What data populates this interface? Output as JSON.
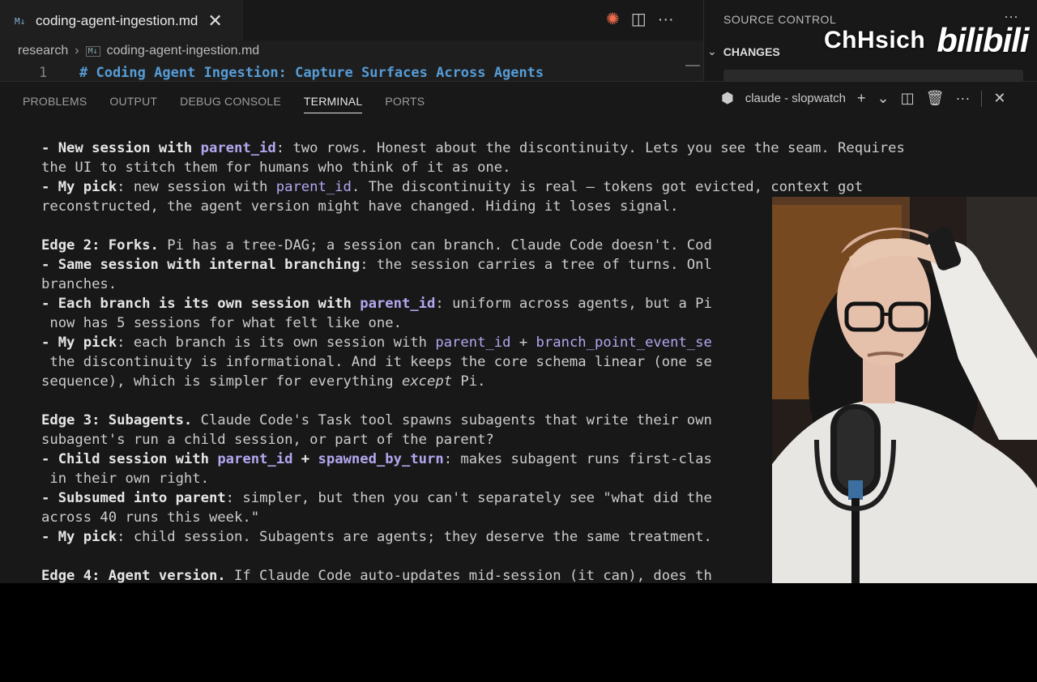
{
  "editor": {
    "tab": {
      "icon": "markdown-icon",
      "icon_text": "M↓",
      "title": "coding-agent-ingestion.md",
      "close": "✕"
    },
    "breadcrumb": {
      "folder": "research",
      "icon_text": "M↓",
      "file": "coding-agent-ingestion.md"
    },
    "line_number": "1",
    "line_text": "# Coding Agent Ingestion: Capture Surfaces Across Agents",
    "actions": [
      "spark-icon",
      "split-editor-icon",
      "more-icon"
    ]
  },
  "source_control": {
    "title": "SOURCE CONTROL",
    "section": "CHANGES",
    "more": "···"
  },
  "watermark": {
    "name": "ChHsich",
    "logo": "bilibili"
  },
  "panel": {
    "tabs": [
      "PROBLEMS",
      "OUTPUT",
      "DEBUG CONSOLE",
      "TERMINAL",
      "PORTS"
    ],
    "active_tab": "TERMINAL",
    "terminal_name": "claude - slopwatch"
  },
  "terminal": {
    "lines": [
      [
        {
          "t": "- ",
          "s": "b"
        },
        {
          "t": "New session with ",
          "s": "b"
        },
        {
          "t": "parent_id",
          "s": "bcode"
        },
        {
          "t": ": two rows. Honest about the discontinuity. Lets you see the seam. Requires"
        }
      ],
      [
        {
          "t": "the UI to stitch them for humans who think of it as one."
        }
      ],
      [
        {
          "t": "- ",
          "s": "b"
        },
        {
          "t": "My pick",
          "s": "b"
        },
        {
          "t": ": new session with "
        },
        {
          "t": "parent_id",
          "s": "code"
        },
        {
          "t": ". The discontinuity is real — tokens got evicted, context got"
        }
      ],
      [
        {
          "t": "reconstructed, the agent version might have changed. Hiding it loses signal."
        }
      ],
      [
        {
          "t": ""
        }
      ],
      [
        {
          "t": "Edge 2: Forks.",
          "s": "b"
        },
        {
          "t": " Pi has a tree-DAG; a session can branch. Claude Code doesn't. Cod"
        }
      ],
      [
        {
          "t": "- ",
          "s": "b"
        },
        {
          "t": "Same session with internal branching",
          "s": "b"
        },
        {
          "t": ": the session carries a tree of turns. Onl"
        }
      ],
      [
        {
          "t": "branches."
        }
      ],
      [
        {
          "t": "- ",
          "s": "b"
        },
        {
          "t": "Each branch is its own session with ",
          "s": "b"
        },
        {
          "t": "parent_id",
          "s": "bcode"
        },
        {
          "t": ": uniform across agents, but a Pi"
        }
      ],
      [
        {
          "t": " now has 5 sessions for what felt like one."
        }
      ],
      [
        {
          "t": "- ",
          "s": "b"
        },
        {
          "t": "My pick",
          "s": "b"
        },
        {
          "t": ": each branch is its own session with "
        },
        {
          "t": "parent_id",
          "s": "code"
        },
        {
          "t": " + "
        },
        {
          "t": "branch_point_event_se",
          "s": "code"
        }
      ],
      [
        {
          "t": " the discontinuity is informational. And it keeps the core schema linear (one se"
        }
      ],
      [
        {
          "t": "sequence), which is simpler for everything "
        },
        {
          "t": "except",
          "s": "it"
        },
        {
          "t": " Pi."
        }
      ],
      [
        {
          "t": ""
        }
      ],
      [
        {
          "t": "Edge 3: Subagents.",
          "s": "b"
        },
        {
          "t": " Claude Code's Task tool spawns subagents that write their own"
        }
      ],
      [
        {
          "t": "subagent's run a child session, or part of the parent?"
        }
      ],
      [
        {
          "t": "- ",
          "s": "b"
        },
        {
          "t": "Child session with ",
          "s": "b"
        },
        {
          "t": "parent_id",
          "s": "bcode"
        },
        {
          "t": " + ",
          "s": "b"
        },
        {
          "t": "spawned_by_turn",
          "s": "bcode"
        },
        {
          "t": ": makes subagent runs first-clas"
        }
      ],
      [
        {
          "t": " in their own right."
        }
      ],
      [
        {
          "t": "- ",
          "s": "b"
        },
        {
          "t": "Subsumed into parent",
          "s": "b"
        },
        {
          "t": ": simpler, but then you can't separately see \"what did the"
        }
      ],
      [
        {
          "t": "across 40 runs this week.\""
        }
      ],
      [
        {
          "t": "- ",
          "s": "b"
        },
        {
          "t": "My pick",
          "s": "b"
        },
        {
          "t": ": child session. Subagents are agents; they deserve the same treatment."
        }
      ],
      [
        {
          "t": ""
        }
      ],
      [
        {
          "t": "Edge 4: Agent version.",
          "s": "b"
        },
        {
          "t": " If Claude Code auto-updates mid-session (it can), does th"
        }
      ]
    ]
  },
  "colors": {
    "editor_bg": "#1e1e1e",
    "panel_bg": "#181818",
    "keyword_blue": "#569cd6",
    "code_purple": "#b4a7f0",
    "spark_orange": "#f26d4f"
  }
}
